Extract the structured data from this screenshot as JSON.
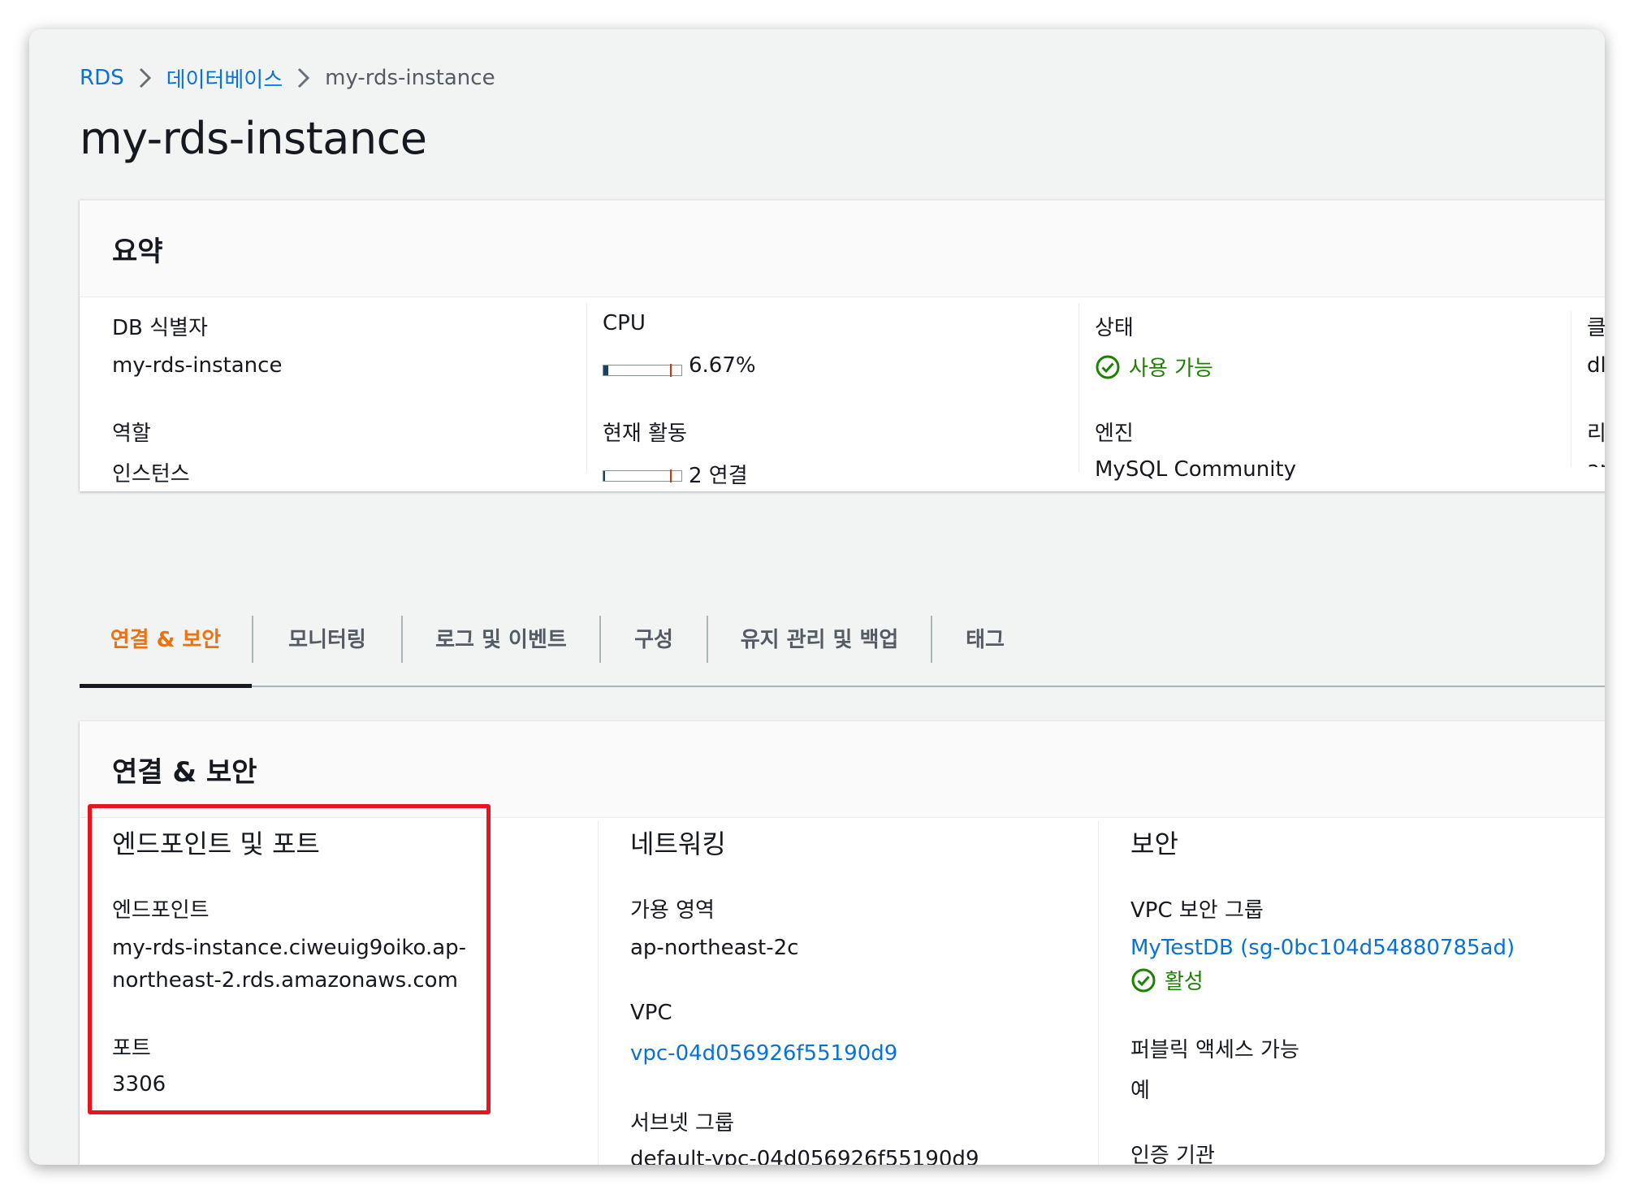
{
  "breadcrumb": {
    "items": [
      "RDS",
      "데이터베이스"
    ],
    "current": "my-rds-instance"
  },
  "page": {
    "title": "my-rds-instance"
  },
  "summary": {
    "heading": "요약",
    "db_id_label": "DB 식별자",
    "db_id_value": "my-rds-instance",
    "role_label": "역할",
    "role_value": "인스턴스",
    "cpu_label": "CPU",
    "cpu_value": "6.67%",
    "cpu_fraction": 0.0667,
    "activity_label": "현재 활동",
    "activity_value": "2 연결",
    "status_label": "상태",
    "status_value": "사용 가능",
    "engine_label": "엔진",
    "engine_value": "MySQL Community",
    "col4_label1": "클",
    "col4_value1": "dl",
    "col4_label2": "리",
    "col4_value2": "ap"
  },
  "tabs": [
    "연결 & 보안",
    "모니터링",
    "로그 및 이벤트",
    "구성",
    "유지 관리 및 백업",
    "태그"
  ],
  "active_tab": "연결 & 보안",
  "connectivity": {
    "heading": "연결 & 보안",
    "endpoint_section": {
      "title": "엔드포인트 및 포트",
      "endpoint_label": "엔드포인트",
      "endpoint_line1": "my-rds-instance.ciweuig9oiko.ap-",
      "endpoint_line2": "northeast-2.rds.amazonaws.com",
      "port_label": "포트",
      "port_value": "3306"
    },
    "network_section": {
      "title": "네트워킹",
      "az_label": "가용 영역",
      "az_value": "ap-northeast-2c",
      "vpc_label": "VPC",
      "vpc_value": "vpc-04d056926f55190d9",
      "subnet_label": "서브넷 그룹",
      "subnet_value": "default-vpc-04d056926f55190d9"
    },
    "security_section": {
      "title": "보안",
      "sg_label": "VPC 보안 그룹",
      "sg_value": "MyTestDB (sg-0bc104d54880785ad)",
      "sg_status": "활성",
      "public_label": "퍼블릭 액세스 가능",
      "public_value": "예",
      "ca_label": "인증 기관"
    }
  },
  "colors": {
    "link": "#0972d3",
    "active_tab": "#ec7211",
    "success": "#1d8102",
    "highlight": "#e8141e"
  }
}
